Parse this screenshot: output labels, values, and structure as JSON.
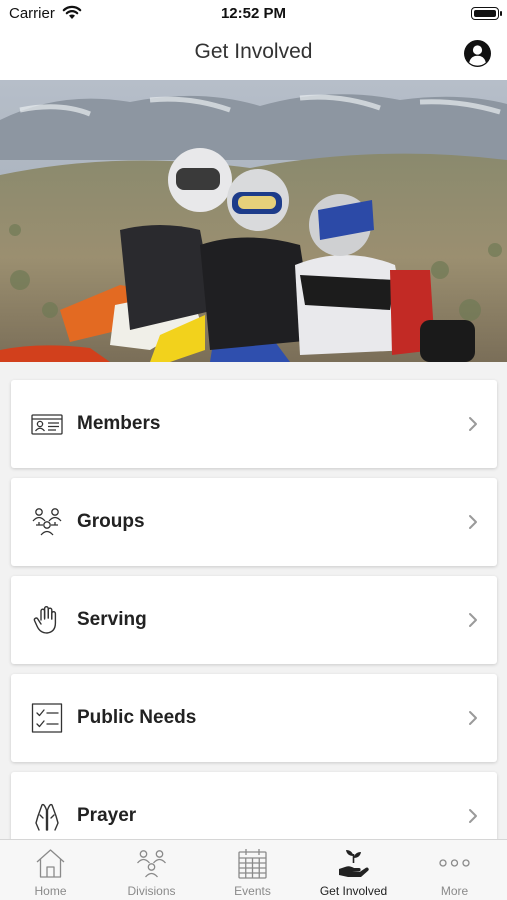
{
  "status_bar": {
    "carrier": "Carrier",
    "time": "12:52 PM"
  },
  "nav": {
    "title": "Get Involved",
    "profile_icon": "person-circle-icon"
  },
  "hero": {
    "image": "dirt-bike-riders-photo"
  },
  "menu": {
    "items": [
      {
        "label": "Members",
        "icon": "id-card-icon"
      },
      {
        "label": "Groups",
        "icon": "people-group-icon"
      },
      {
        "label": "Serving",
        "icon": "raised-hand-icon"
      },
      {
        "label": "Public Needs",
        "icon": "checklist-icon"
      },
      {
        "label": "Prayer",
        "icon": "praying-hands-icon"
      }
    ]
  },
  "tabs": [
    {
      "label": "Home",
      "icon": "home-icon",
      "active": false
    },
    {
      "label": "Divisions",
      "icon": "people-group-icon",
      "active": false
    },
    {
      "label": "Events",
      "icon": "calendar-icon",
      "active": false
    },
    {
      "label": "Get Involved",
      "icon": "hand-plant-icon",
      "active": true
    },
    {
      "label": "More",
      "icon": "more-dots-icon",
      "active": false
    }
  ],
  "colors": {
    "active_tab": "#222222",
    "inactive_tab": "#8a8a8a",
    "nav_background": "#ffffff",
    "page_background": "#f2f2f2"
  }
}
